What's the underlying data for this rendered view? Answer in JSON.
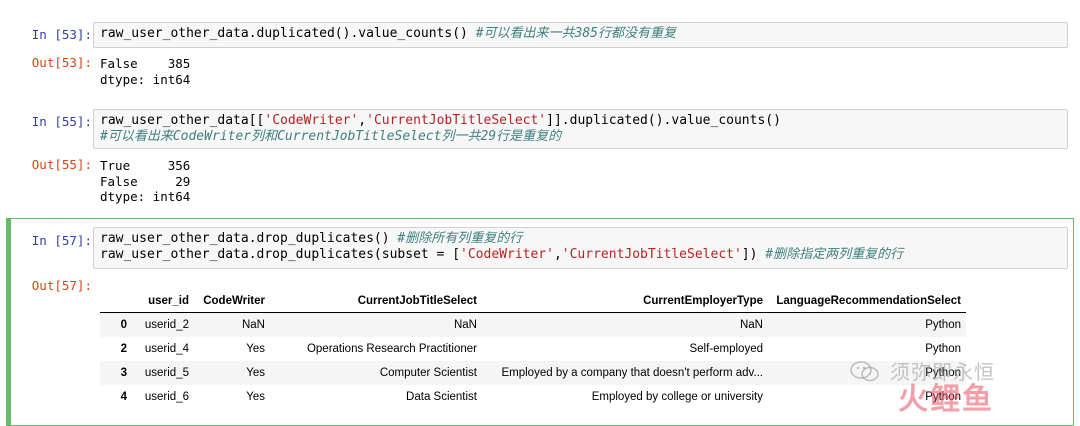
{
  "cells": [
    {
      "in_prompt": "In [53]:",
      "code": [
        [
          {
            "t": "raw_user_other_data.duplicated().value_counts() "
          },
          {
            "t": "#可以看出来一共385行都没有重复",
            "c": "cmt"
          }
        ]
      ],
      "out_prompt": "Out[53]:",
      "output": "False    385\ndtype: int64"
    },
    {
      "in_prompt": "In [55]:",
      "code": [
        [
          {
            "t": "raw_user_other_data[["
          },
          {
            "t": "'CodeWriter'",
            "c": "str"
          },
          {
            "t": ","
          },
          {
            "t": "'CurrentJobTitleSelect'",
            "c": "str"
          },
          {
            "t": "]].duplicated().value_counts()"
          }
        ],
        [
          {
            "t": "#可以看出来CodeWriter列和CurrentJobTitleSelect列一共29行是重复的",
            "c": "cmt"
          }
        ]
      ],
      "out_prompt": "Out[55]:",
      "output": "True     356\nFalse     29\ndtype: int64"
    },
    {
      "in_prompt": "In [57]:",
      "code": [
        [
          {
            "t": "raw_user_other_data.drop_duplicates() "
          },
          {
            "t": "#删除所有列重复的行",
            "c": "cmt"
          }
        ],
        [
          {
            "t": "raw_user_other_data.drop_duplicates(subset = ["
          },
          {
            "t": "'CodeWriter'",
            "c": "str"
          },
          {
            "t": ","
          },
          {
            "t": "'CurrentJobTitleSelect'",
            "c": "str"
          },
          {
            "t": "]) "
          },
          {
            "t": "#删除指定两列重复的行",
            "c": "cmt"
          }
        ]
      ],
      "out_prompt": "Out[57]:"
    }
  ],
  "dataframe": {
    "columns": [
      "",
      "user_id",
      "CodeWriter",
      "CurrentJobTitleSelect",
      "CurrentEmployerType",
      "LanguageRecommendationSelect"
    ],
    "rows": [
      [
        "0",
        "userid_2",
        "NaN",
        "NaN",
        "NaN",
        "Python"
      ],
      [
        "2",
        "userid_4",
        "Yes",
        "Operations Research Practitioner",
        "Self-employed",
        "Python"
      ],
      [
        "3",
        "userid_5",
        "Yes",
        "Computer Scientist",
        "Employed by a company that doesn't perform adv...",
        "Python"
      ],
      [
        "4",
        "userid_6",
        "Yes",
        "Data Scientist",
        "Employed by college or university",
        "Python"
      ]
    ]
  },
  "watermark": {
    "line1": "须弥即永恒",
    "line2": "火鲤鱼",
    "logo_icon": "wechat-icon"
  },
  "colors": {
    "in_prompt": "#303f9f",
    "out_prompt": "#d84315",
    "string": "#ba2121",
    "comment": "#408080",
    "selected_border": "#66bb6a"
  }
}
